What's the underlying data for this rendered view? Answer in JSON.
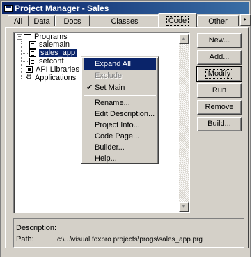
{
  "window": {
    "title": "Project Manager - Sales"
  },
  "tabs": [
    {
      "label": "All"
    },
    {
      "label": "Data"
    },
    {
      "label": "Docs"
    },
    {
      "label": "Classes"
    },
    {
      "label": "Code"
    },
    {
      "label": "Other"
    }
  ],
  "tab_scroll": {
    "icon": "arrow-icon",
    "glyph": "▸"
  },
  "tree": {
    "programs": "Programs",
    "items": [
      "salemain",
      "sales_app",
      "setconf"
    ],
    "api_libraries": "API Libraries",
    "applications": "Applications"
  },
  "buttons": {
    "new": "New...",
    "add": "Add...",
    "modify": "Modify",
    "run": "Run",
    "remove": "Remove",
    "build": "Build..."
  },
  "context_menu": [
    {
      "label": "Expand All",
      "state": "highlighted"
    },
    {
      "label": "Exclude",
      "state": "disabled"
    },
    {
      "label": "Set Main",
      "state": "checked",
      "check": "✔"
    },
    {
      "label": "Rename..."
    },
    {
      "label": "Edit Description..."
    },
    {
      "label": "Project Info..."
    },
    {
      "label": "Code Page..."
    },
    {
      "label": "Builder..."
    },
    {
      "label": "Help..."
    }
  ],
  "info": {
    "description_label": "Description:",
    "description_value": "",
    "path_label": "Path:",
    "path_value": "c:\\...\\visual foxpro projects\\progs\\sales_app.prg"
  },
  "colors": {
    "title_bar": "#0a246a",
    "face": "#d4d0c8",
    "highlight": "#0a246a"
  }
}
